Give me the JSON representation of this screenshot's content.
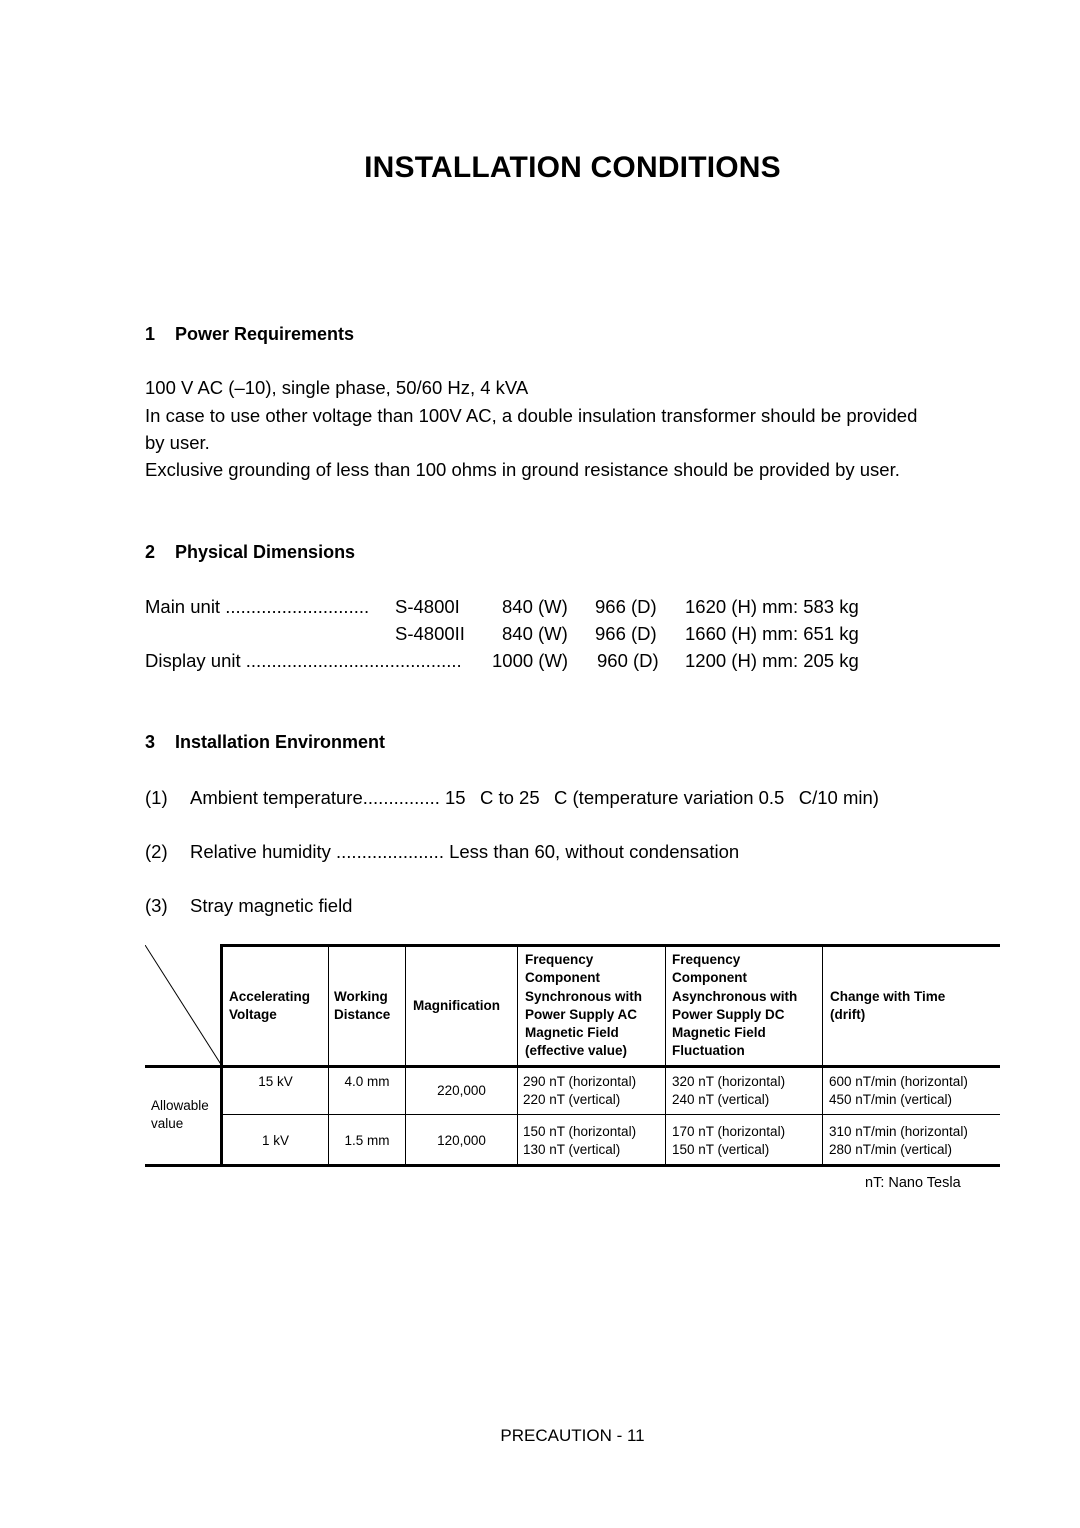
{
  "title": "INSTALLATION CONDITIONS",
  "sections": [
    {
      "number": "1",
      "heading": "Power Requirements",
      "paragraphs": [
        "100 V AC (–10), single phase, 50/60 Hz, 4 kVA",
        "In case to use other voltage than 100V AC, a double insulation transformer should be provided",
        "by user.",
        "Exclusive grounding of less than 100 ohms in ground resistance should be provided by user."
      ]
    },
    {
      "number": "2",
      "heading": "Physical Dimensions",
      "rows": [
        {
          "label": "Main unit",
          "dots": "............................",
          "model": "S-4800I",
          "w": "840 (W)",
          "d": "966 (D)",
          "h": "1620 (H) mm: 583 kg"
        },
        {
          "label": "",
          "dots": "",
          "model": "S-4800II",
          "w": "840 (W)",
          "d": "966 (D)",
          "h": "1660 (H) mm: 651 kg"
        },
        {
          "label": "Display unit",
          "dots": "..........................................",
          "model": "",
          "w": "1000 (W)",
          "d": "960 (D)",
          "h": "1200 (H) mm: 205 kg"
        }
      ]
    },
    {
      "number": "3",
      "heading": "Installation Environment",
      "items": [
        {
          "num": "(1)",
          "label": "Ambient temperature",
          "dots": "...............",
          "value": "15  C to 25  C (temperature variation 0.5  C/10 min)"
        },
        {
          "num": "(2)",
          "label": "Relative humidity",
          "dots": ".....................",
          "value": "Less than 60, without condensation"
        },
        {
          "num": "(3)",
          "label": "Stray magnetic field",
          "dots": "",
          "value": ""
        }
      ]
    }
  ],
  "table": {
    "headers": [
      "Accelerating\nVoltage",
      "Working\nDistance",
      "Magnification",
      "Frequency\nComponent\nSynchronous with\nPower Supply AC\nMagnetic Field\n(effective value)",
      "Frequency\nComponent\nAsynchronous with\nPower Supply DC\nMagnetic Field\nFluctuation",
      "Change with Time\n(drift)"
    ],
    "row_label": "Allowable\nvalue",
    "rows": [
      [
        "15 kV",
        "4.0 mm",
        "220,000",
        "290 nT (horizontal)\n220 nT (vertical)",
        "320 nT (horizontal)\n240 nT (vertical)",
        "600 nT/min (horizontal)\n450 nT/min (vertical)"
      ],
      [
        "1 kV",
        "1.5 mm",
        "120,000",
        "150 nT (horizontal)\n130 nT (vertical)",
        "170 nT (horizontal)\n150 nT (vertical)",
        "310 nT/min (horizontal)\n280 nT/min (vertical)"
      ]
    ],
    "note": "nT: Nano Tesla"
  },
  "footer": "PRECAUTION - 11"
}
